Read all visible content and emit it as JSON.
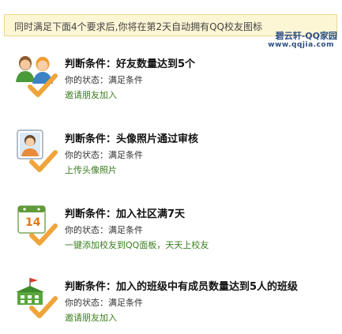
{
  "notice": {
    "text": "同时满足下面4个要求后,你将在第2天自动拥有QQ校友图标"
  },
  "watermark": {
    "line1": "碧云轩-QQ家园",
    "line2": "www.qqjia.com"
  },
  "conditions": [
    {
      "title": "判断条件：好友数量达到5个",
      "status": "你的状态：满足条件",
      "action": "邀请朋友加入",
      "icon": "friends-icon"
    },
    {
      "title": "判断条件：头像照片通过审核",
      "status": "你的状态：满足条件",
      "action": "上传头像照片",
      "icon": "avatar-photo-icon"
    },
    {
      "title": "判断条件：加入社区满7天",
      "status": "你的状态：满足条件",
      "action": "一键添加校友到QQ面板",
      "separator": "，",
      "action2": "天天上校友",
      "icon": "calendar-icon",
      "calendar_day": "14"
    },
    {
      "title": "判断条件：加入的班级中有成员数量达到5人的班级",
      "status": "你的状态：满足条件",
      "action": "邀请朋友加入",
      "icon": "class-building-icon"
    }
  ],
  "colors": {
    "notice_bg": "#fdf6d5",
    "notice_border": "#ecd88e",
    "link_green": "#3a7d1d",
    "check_orange": "#f0a43a"
  }
}
